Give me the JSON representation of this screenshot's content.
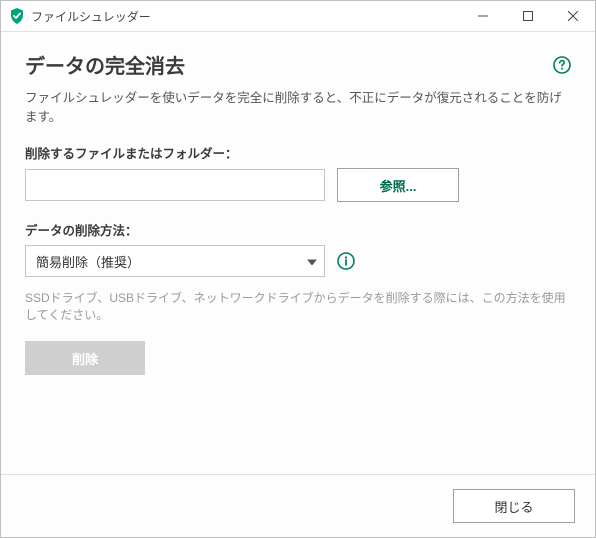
{
  "titlebar": {
    "title": "ファイルシュレッダー"
  },
  "page": {
    "title": "データの完全消去",
    "description": "ファイルシュレッダーを使いデータを完全に削除すると、不正にデータが復元されることを防げます。"
  },
  "file_field": {
    "label": "削除するファイルまたはフォルダー：",
    "value": "",
    "browse_label": "参照..."
  },
  "method_field": {
    "label": "データの削除方法：",
    "selected": "簡易削除（推奨）"
  },
  "note": "SSDドライブ、USBドライブ、ネットワークドライブからデータを削除する際には、この方法を使用してください。",
  "actions": {
    "delete_label": "削除",
    "close_label": "閉じる"
  }
}
